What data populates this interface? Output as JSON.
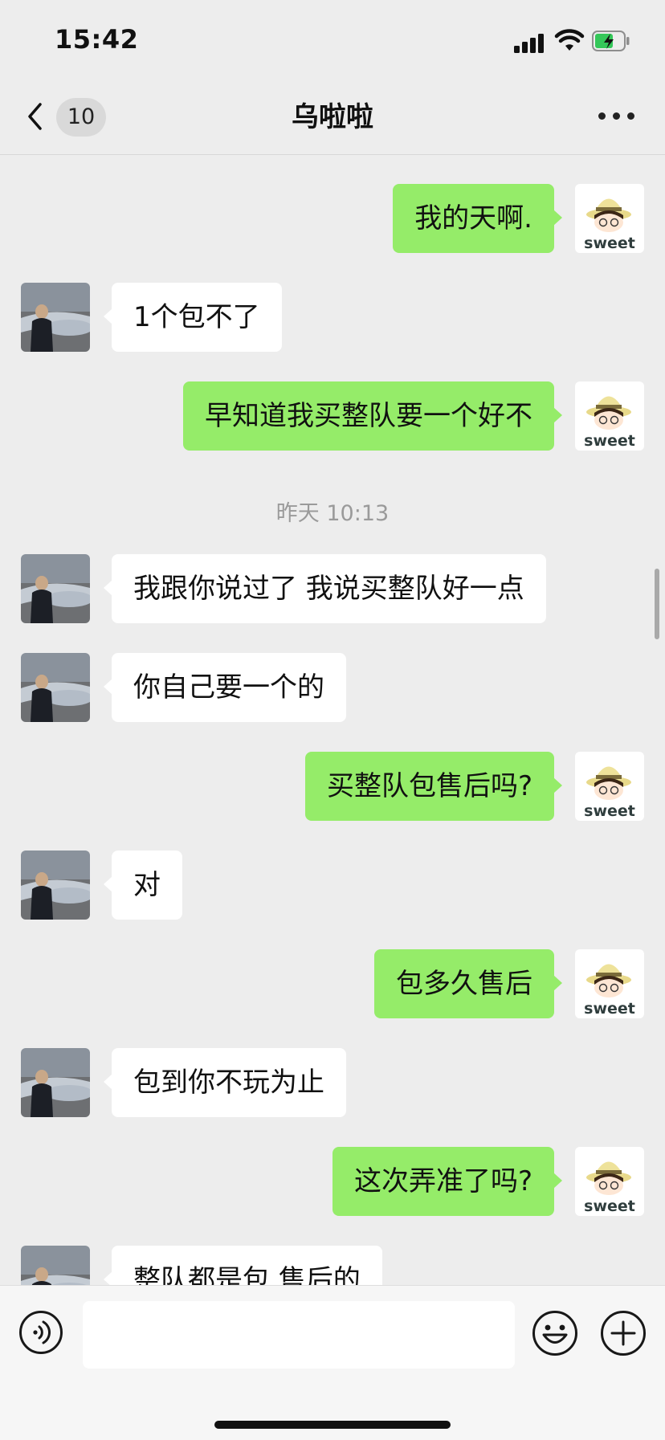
{
  "status_bar": {
    "time": "15:42"
  },
  "nav": {
    "unread_count": "10",
    "title": "乌啦啦"
  },
  "avatar": {
    "self_label": "sweet"
  },
  "messages": [
    {
      "side": "right",
      "text": "我的天啊."
    },
    {
      "side": "left",
      "text": "1个包不了"
    },
    {
      "side": "right",
      "text": "早知道我买整队要一个好不"
    },
    {
      "type": "time",
      "text": "昨天 10:13"
    },
    {
      "side": "left",
      "text": "我跟你说过了 我说买整队好一点"
    },
    {
      "side": "left",
      "text": "你自己要一个的"
    },
    {
      "side": "right",
      "text": "买整队包售后吗?"
    },
    {
      "side": "left",
      "text": "对"
    },
    {
      "side": "right",
      "text": "包多久售后"
    },
    {
      "side": "left",
      "text": "包到你不玩为止"
    },
    {
      "side": "right",
      "text": "这次弄准了吗?"
    },
    {
      "side": "left",
      "text": "整队都是包 售后的"
    }
  ],
  "input": {
    "value": ""
  },
  "colors": {
    "outgoing_bubble": "#95ec69",
    "incoming_bubble": "#ffffff",
    "background": "#ededed"
  },
  "icons": [
    "back-chevron-icon",
    "more-dots-icon",
    "voice-icon",
    "emoji-icon",
    "plus-icon",
    "signal-icon",
    "wifi-icon",
    "battery-icon"
  ]
}
